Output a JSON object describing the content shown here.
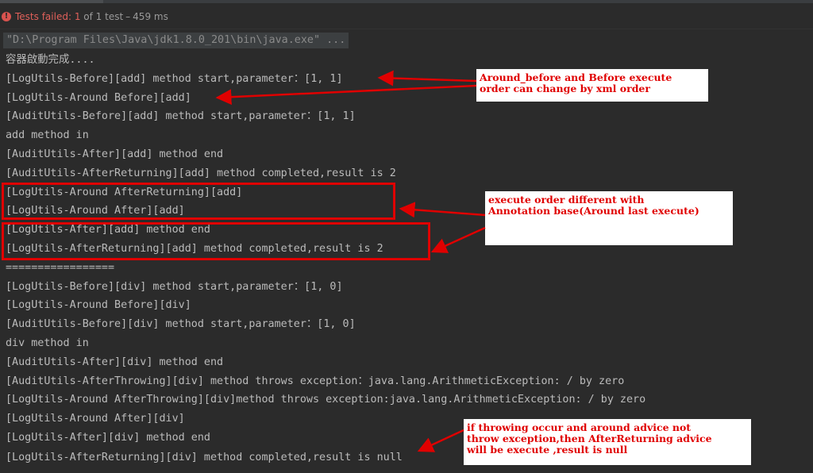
{
  "status_bar": {
    "label": "Tests failed:",
    "failed_count": "1",
    "of_text": "of 1 test",
    "separator": "–",
    "duration": "459 ms",
    "icon": "error-icon",
    "icon_glyph": "!"
  },
  "console": {
    "command": "\"D:\\Program Files\\Java\\jdk1.8.0_201\\bin\\java.exe\" ...",
    "lines": [
      "容器啟動完成....",
      "[LogUtils-Before][add] method start,parameter：[1, 1]",
      "[LogUtils-Around Before][add]",
      "[AuditUtils-Before][add] method start,parameter：[1, 1]",
      "add method in",
      "[AuditUtils-After][add] method end",
      "[AuditUtils-AfterReturning][add] method completed,result is 2",
      "[LogUtils-Around AfterReturning][add]",
      "[LogUtils-Around After][add]",
      "[LogUtils-After][add] method end",
      "[LogUtils-AfterReturning][add] method completed,result is 2",
      "=================",
      "[LogUtils-Before][div] method start,parameter：[1, 0]",
      "[LogUtils-Around Before][div]",
      "[AuditUtils-Before][div] method start,parameter：[1, 0]",
      "div method in",
      "[AuditUtils-After][div] method end",
      "[AuditUtils-AfterThrowing][div] method throws exception：java.lang.ArithmeticException: / by zero",
      "[LogUtils-Around AfterThrowing][div]method throws exception:java.lang.ArithmeticException: / by zero",
      "[LogUtils-Around After][div]",
      "[LogUtils-After][div] method end",
      "[LogUtils-AfterReturning][div] method completed,result is null"
    ]
  },
  "annotations": [
    {
      "lines": [
        "Around_before and Before execute",
        "order can change by xml order"
      ]
    },
    {
      "lines": [
        "execute order different with",
        "Annotation base(Around last execute)"
      ]
    },
    {
      "lines": [
        "if throwing occur and around advice not",
        "throw exception,then AfterReturning advice",
        "will be execute ,result is null"
      ]
    }
  ],
  "colors": {
    "background": "#2b2b2b",
    "text": "#bbbbbb",
    "error": "#d9534f",
    "annotation_red": "#e00000",
    "annotation_bg": "#ffffff"
  }
}
